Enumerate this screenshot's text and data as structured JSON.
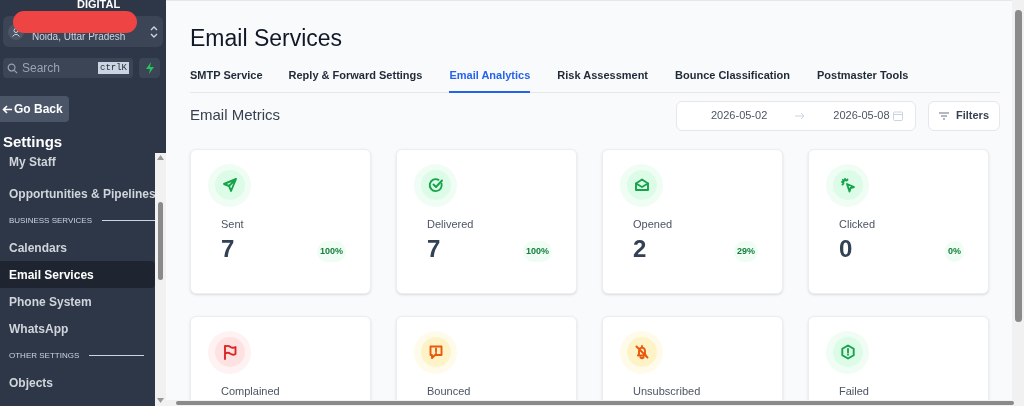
{
  "sidebar": {
    "brand": "DIGITAL",
    "location": {
      "subtitle": "Noida, Uttar Pradesh"
    },
    "search": {
      "placeholder": "Search",
      "shortcut": "ctrlK"
    },
    "back_button": "Go Back",
    "section_title": "Settings",
    "items": [
      {
        "kind": "item",
        "label": "My Staff",
        "selected": false
      },
      {
        "kind": "item",
        "label": "Opportunities & Pipelines",
        "selected": false
      },
      {
        "kind": "header",
        "label": "BUSINESS SERVICES"
      },
      {
        "kind": "item",
        "label": "Calendars",
        "selected": false
      },
      {
        "kind": "item",
        "label": "Email Services",
        "selected": true
      },
      {
        "kind": "item",
        "label": "Phone System",
        "selected": false
      },
      {
        "kind": "item",
        "label": "WhatsApp",
        "selected": false
      },
      {
        "kind": "header",
        "label": "OTHER SETTINGS"
      },
      {
        "kind": "item",
        "label": "Objects",
        "selected": false
      }
    ]
  },
  "page": {
    "title": "Email Services",
    "tabs": [
      {
        "label": "SMTP Service",
        "selected": false
      },
      {
        "label": "Reply & Forward Settings",
        "selected": false
      },
      {
        "label": "Email Analytics",
        "selected": true
      },
      {
        "label": "Risk Assessment",
        "selected": false
      },
      {
        "label": "Bounce Classification",
        "selected": false
      },
      {
        "label": "Postmaster Tools",
        "selected": false
      }
    ],
    "section_title": "Email Metrics",
    "date_from": "2026-05-02",
    "date_to": "2026-05-08",
    "filters_button": "Filters",
    "metrics": [
      {
        "label": "Sent",
        "value": "7",
        "percent": "100%",
        "color": "#16a34a"
      },
      {
        "label": "Delivered",
        "value": "7",
        "percent": "100%",
        "color": "#16a34a"
      },
      {
        "label": "Opened",
        "value": "2",
        "percent": "29%",
        "color": "#16a34a"
      },
      {
        "label": "Clicked",
        "value": "0",
        "percent": "0%",
        "color": "#16a34a"
      },
      {
        "label": "Complained",
        "color": "#dc2626"
      },
      {
        "label": "Bounced",
        "color": "#ea580c"
      },
      {
        "label": "Unsubscribed",
        "color": "#ea580c"
      },
      {
        "label": "Failed",
        "color": "#16a34a"
      }
    ]
  }
}
